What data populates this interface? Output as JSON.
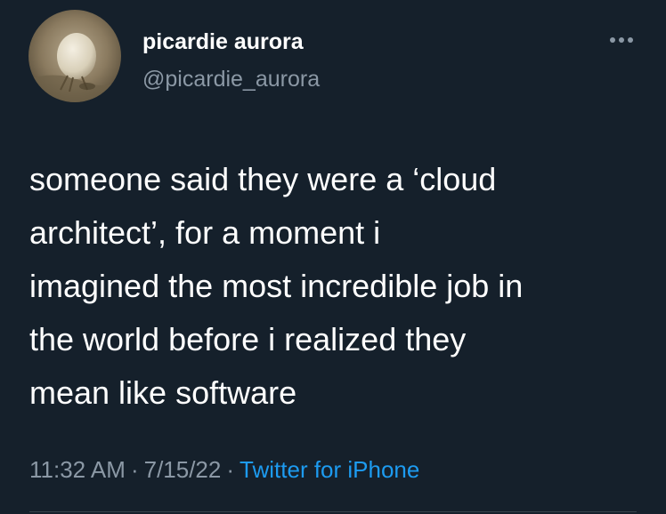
{
  "author": {
    "display_name": "picardie aurora",
    "handle": "@picardie_aurora"
  },
  "avatar_icon": "bird-avatar-icon",
  "more_icon": "more-options-icon",
  "tweet": {
    "lines": [
      "someone said they were a ‘cloud",
      "architect’, for a moment i",
      "imagined the most incredible job in",
      "the world before i realized they",
      "mean like software"
    ]
  },
  "meta": {
    "time": "11:32 AM",
    "separator": "·",
    "date": "7/15/22",
    "source": "Twitter for iPhone"
  },
  "colors": {
    "background": "#15202b",
    "text": "#ffffff",
    "secondary": "#8b98a5",
    "accent": "#1d9bf0"
  }
}
